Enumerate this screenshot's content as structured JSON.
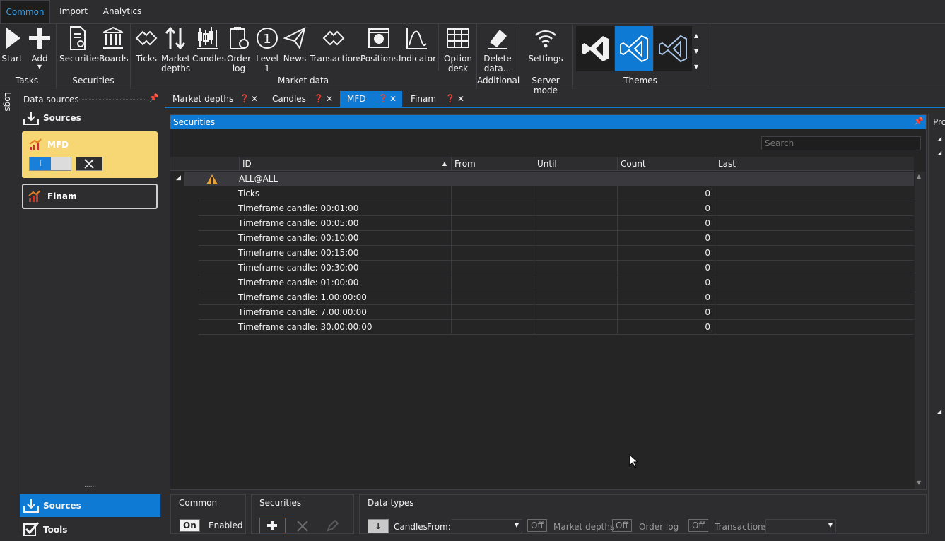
{
  "menu": {
    "tabs": [
      "Common",
      "Import",
      "Analytics"
    ],
    "active": "Common"
  },
  "ribbon": {
    "tasks": {
      "start": "Start",
      "add": "Add",
      "group": "Tasks"
    },
    "securities": {
      "securities": "Securities",
      "boards": "Boards",
      "group": "Securities"
    },
    "market_data": {
      "ticks": "Ticks",
      "market_depths_1": "Market",
      "market_depths_2": "depths",
      "candles": "Candles",
      "order_log_1": "Order",
      "order_log_2": "log",
      "level1_1": "Level",
      "level1_2": "1",
      "news": "News",
      "transactions": "Transactions",
      "positions": "Positions",
      "indicator": "Indicator",
      "option_desk_1": "Option",
      "option_desk_2": "desk",
      "group": "Market data"
    },
    "additional": {
      "delete_1": "Delete",
      "delete_2": "data...",
      "group": "Additional"
    },
    "server_mode": {
      "settings": "Settings",
      "group": "Server mode"
    },
    "themes": {
      "group": "Themes"
    }
  },
  "left_strip": {
    "logs": "Logs"
  },
  "data_sources": {
    "title": "Data sources",
    "sources_header": "Sources",
    "cards": [
      {
        "name": "MFD",
        "toggle": "I"
      },
      {
        "name": "Finam"
      }
    ],
    "resize_grip": "......",
    "bottom_tabs": [
      {
        "label": "Sources"
      },
      {
        "label": "Tools"
      }
    ]
  },
  "doc_tabs": [
    {
      "label": "Market depths"
    },
    {
      "label": "Candles"
    },
    {
      "label": "MFD"
    },
    {
      "label": "Finam"
    }
  ],
  "securities_pane": {
    "title": "Securities",
    "search_placeholder": "Search",
    "columns": [
      "ID",
      "From",
      "Until",
      "Count",
      "Last"
    ],
    "group_row": "ALL@ALL",
    "rows": [
      {
        "id": "Ticks",
        "count": "0"
      },
      {
        "id": "Timeframe candle: 00:01:00",
        "count": "0"
      },
      {
        "id": "Timeframe candle: 00:05:00",
        "count": "0"
      },
      {
        "id": "Timeframe candle: 00:10:00",
        "count": "0"
      },
      {
        "id": "Timeframe candle: 00:15:00",
        "count": "0"
      },
      {
        "id": "Timeframe candle: 00:30:00",
        "count": "0"
      },
      {
        "id": "Timeframe candle: 01:00:00",
        "count": "0"
      },
      {
        "id": "Timeframe candle: 1.00:00:00",
        "count": "0"
      },
      {
        "id": "Timeframe candle: 7.00:00:00",
        "count": "0"
      },
      {
        "id": "Timeframe candle: 30.00:00:00",
        "count": "0"
      }
    ]
  },
  "bottom_panels": {
    "common": {
      "title": "Common",
      "toggle": "On",
      "label": "Enabled"
    },
    "securities": {
      "title": "Securities"
    },
    "data_types": {
      "title": "Data types",
      "candles": "Candles",
      "from": "From:",
      "off": "Off",
      "market_depths": "Market depths",
      "order_log": "Order log",
      "transactions": "Transactions"
    }
  },
  "right_strip": {
    "label": "Pro"
  },
  "colors": {
    "accent": "#0e7ad3",
    "mfd_card": "#f7d774",
    "background": "#2d2d30",
    "warning": "#e8a33c"
  }
}
